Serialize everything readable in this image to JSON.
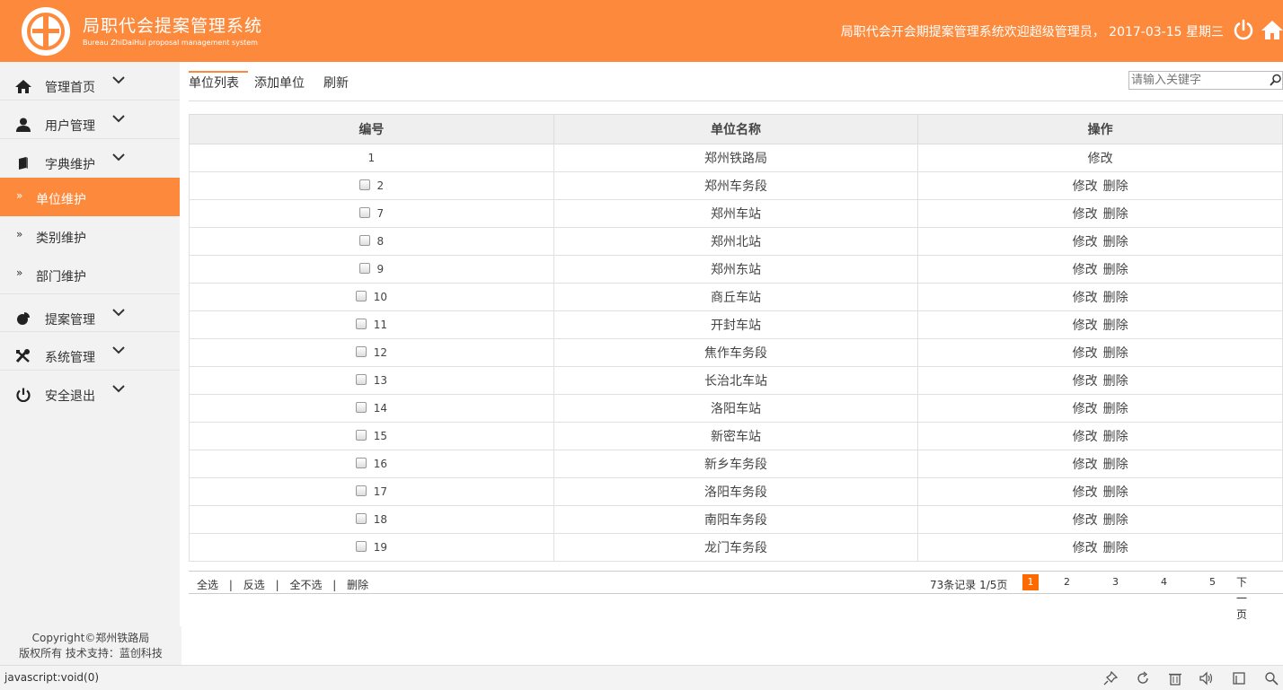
{
  "header": {
    "title": "局职代会提案管理系统",
    "subtitle": "Bureau ZhiDaiHui proposal management system",
    "welcome": "局职代会开会期提案管理系统欢迎超级管理员， 2017-03-15 星期三"
  },
  "sidebar": {
    "items": [
      {
        "label": "管理首页",
        "icon": "home-icon"
      },
      {
        "label": "用户管理",
        "icon": "user-icon"
      },
      {
        "label": "字典维护",
        "icon": "book-icon"
      }
    ],
    "sub_items": [
      {
        "label": "单位维护",
        "active": true
      },
      {
        "label": "类别维护",
        "active": false
      },
      {
        "label": "部门维护",
        "active": false
      }
    ],
    "items_after": [
      {
        "label": "提案管理",
        "icon": "pie-icon"
      },
      {
        "label": "系统管理",
        "icon": "tools-icon"
      },
      {
        "label": "安全退出",
        "icon": "power-icon"
      }
    ],
    "copyright_line1": "Copyright©郑州铁路局",
    "copyright_line2": "版权所有 技术支持：蓝创科技"
  },
  "toolbar": {
    "tab_list": "单位列表",
    "tab_add": "添加单位",
    "tab_refresh": "刷新",
    "search_placeholder": "请输入关键字"
  },
  "table": {
    "headers": [
      "编号",
      "单位名称",
      "操作"
    ],
    "edit_label": "修改",
    "delete_label": "删除",
    "rows": [
      {
        "id": "1",
        "name": "郑州铁路局",
        "checkbox": false,
        "deletable": false
      },
      {
        "id": "2",
        "name": "郑州车务段",
        "checkbox": true,
        "deletable": true
      },
      {
        "id": "7",
        "name": "郑州车站",
        "checkbox": true,
        "deletable": true
      },
      {
        "id": "8",
        "name": "郑州北站",
        "checkbox": true,
        "deletable": true
      },
      {
        "id": "9",
        "name": "郑州东站",
        "checkbox": true,
        "deletable": true
      },
      {
        "id": "10",
        "name": "商丘车站",
        "checkbox": true,
        "deletable": true
      },
      {
        "id": "11",
        "name": "开封车站",
        "checkbox": true,
        "deletable": true
      },
      {
        "id": "12",
        "name": "焦作车务段",
        "checkbox": true,
        "deletable": true
      },
      {
        "id": "13",
        "name": "长治北车站",
        "checkbox": true,
        "deletable": true
      },
      {
        "id": "14",
        "name": "洛阳车站",
        "checkbox": true,
        "deletable": true
      },
      {
        "id": "15",
        "name": "新密车站",
        "checkbox": true,
        "deletable": true
      },
      {
        "id": "16",
        "name": "新乡车务段",
        "checkbox": true,
        "deletable": true
      },
      {
        "id": "17",
        "name": "洛阳车务段",
        "checkbox": true,
        "deletable": true
      },
      {
        "id": "18",
        "name": "南阳车务段",
        "checkbox": true,
        "deletable": true
      },
      {
        "id": "19",
        "name": "龙门车务段",
        "checkbox": true,
        "deletable": true
      }
    ]
  },
  "footer": {
    "select_all": "全选",
    "invert": "反选",
    "select_none": "全不选",
    "delete": "删除",
    "separator": "|",
    "record_info": "73条记录 1/5页",
    "pages": [
      "1",
      "2",
      "3",
      "4",
      "5"
    ],
    "current_page": "1",
    "next": "下一页"
  },
  "statusbar": {
    "url": "javascript:void(0)",
    "icons": [
      "pin-icon",
      "refresh-icon",
      "trash-icon",
      "sound-icon",
      "window-icon",
      "zoom-icon"
    ]
  },
  "colors": {
    "brand_orange": "#fd8a3c",
    "page_active": "#fd6a00"
  }
}
